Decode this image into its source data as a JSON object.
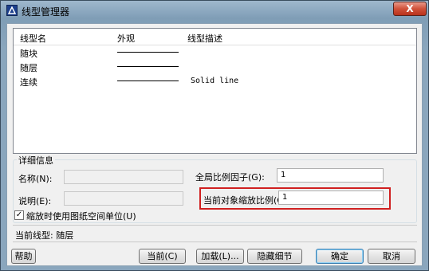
{
  "window": {
    "title": "线型管理器",
    "close_label": "X"
  },
  "icons": {
    "app": "autocad-app-icon",
    "close": "close-icon",
    "check": "checkmark-icon"
  },
  "colors": {
    "highlight": "#d02020",
    "titlebar": "#8aa6bd",
    "close": "#c8442c"
  },
  "list": {
    "columns": [
      "线型名",
      "外观",
      "线型描述"
    ],
    "rows": [
      {
        "name": "随块",
        "desc": ""
      },
      {
        "name": "随层",
        "desc": ""
      },
      {
        "name": "连续",
        "desc": "Solid line"
      }
    ]
  },
  "details": {
    "group_title": "详细信息",
    "name_label": "名称(N):",
    "desc_label": "说明(E):",
    "global_scale_label": "全局比例因子(G):",
    "global_scale_value": "1",
    "object_scale_label": "当前对象缩放比例(O):",
    "object_scale_value": "1",
    "paperspace_checkbox_label": "缩放时使用图纸空间单位(U)",
    "paperspace_checked": true
  },
  "current": {
    "label": "当前线型:  随层"
  },
  "buttons": {
    "help": "帮助",
    "set_current": "当前(C)",
    "load": "加载(L)...",
    "hide_details": "隐藏细节",
    "ok": "确定",
    "cancel": "取消"
  }
}
